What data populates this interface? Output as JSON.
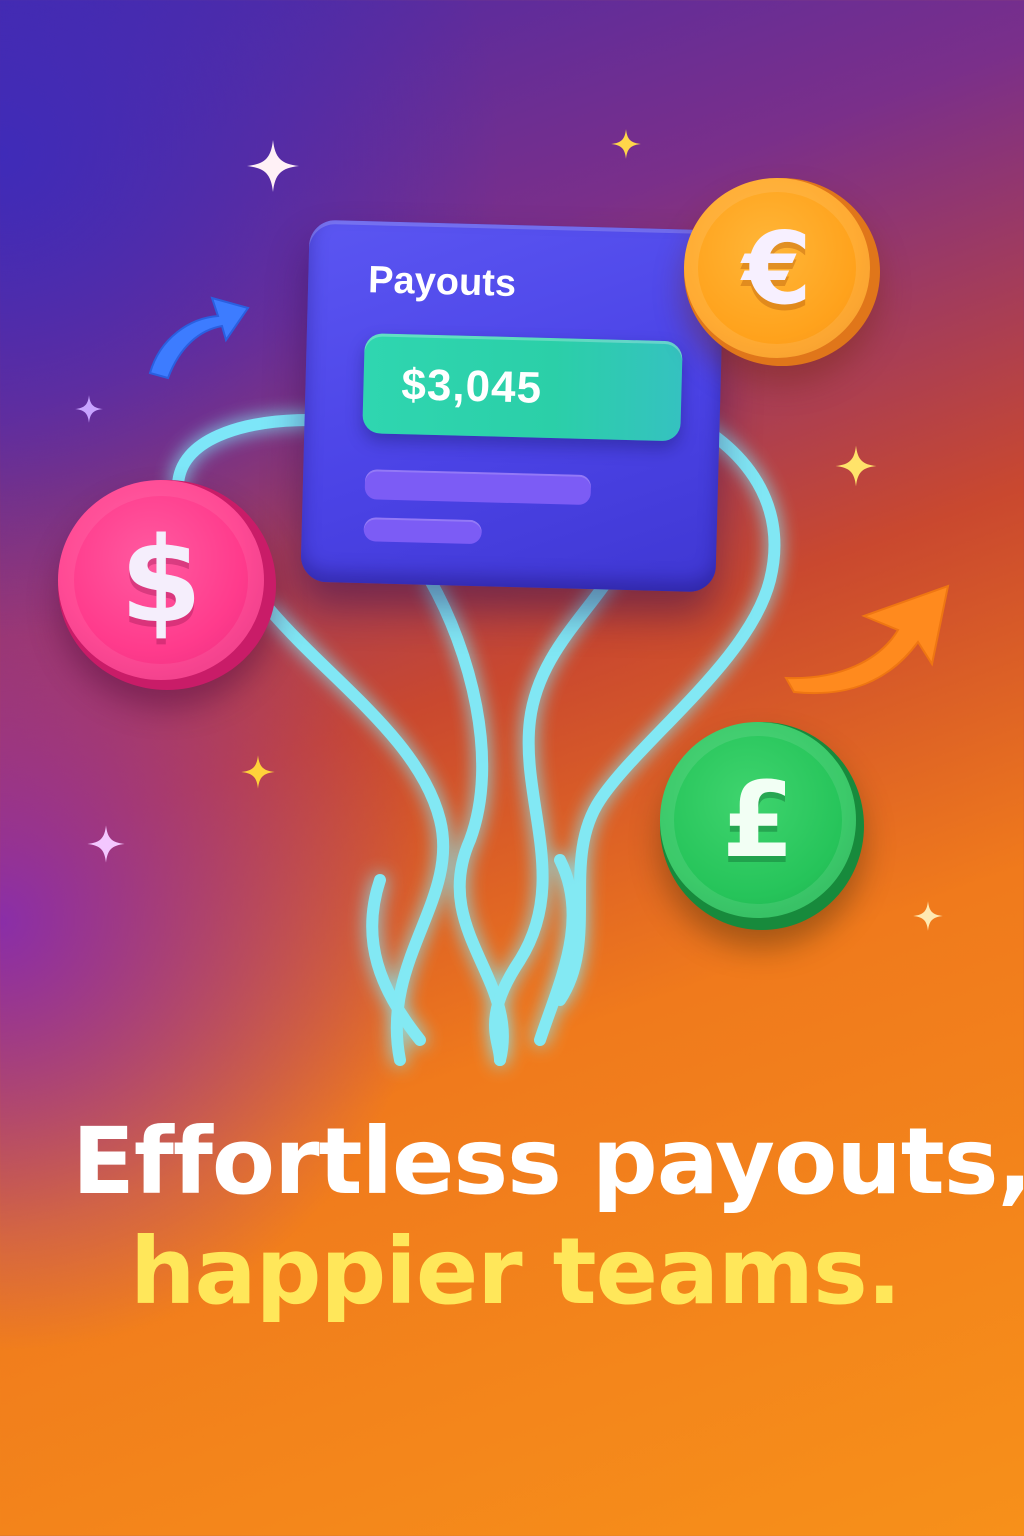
{
  "card": {
    "title": "Payouts",
    "amount": "$3,045"
  },
  "coins": [
    {
      "name": "coin-dollar",
      "glyph": "$",
      "color": "#ff3b8c"
    },
    {
      "name": "coin-euro",
      "glyph": "€",
      "color": "#ffa21c"
    },
    {
      "name": "coin-pound",
      "glyph": "£",
      "color": "#26c45a"
    }
  ],
  "headline": {
    "line1": "Effortless payouts,",
    "line2": "happier teams."
  },
  "colors": {
    "card": "#4b43e6",
    "amount_box": "#2bcfa8",
    "streams": "#7ef0ff",
    "headline_primary": "#ffffff",
    "headline_accent": "#ffe75a"
  },
  "icons": [
    "arrow-up-right-icon",
    "arrow-up-right-icon",
    "sparkle-icon"
  ]
}
